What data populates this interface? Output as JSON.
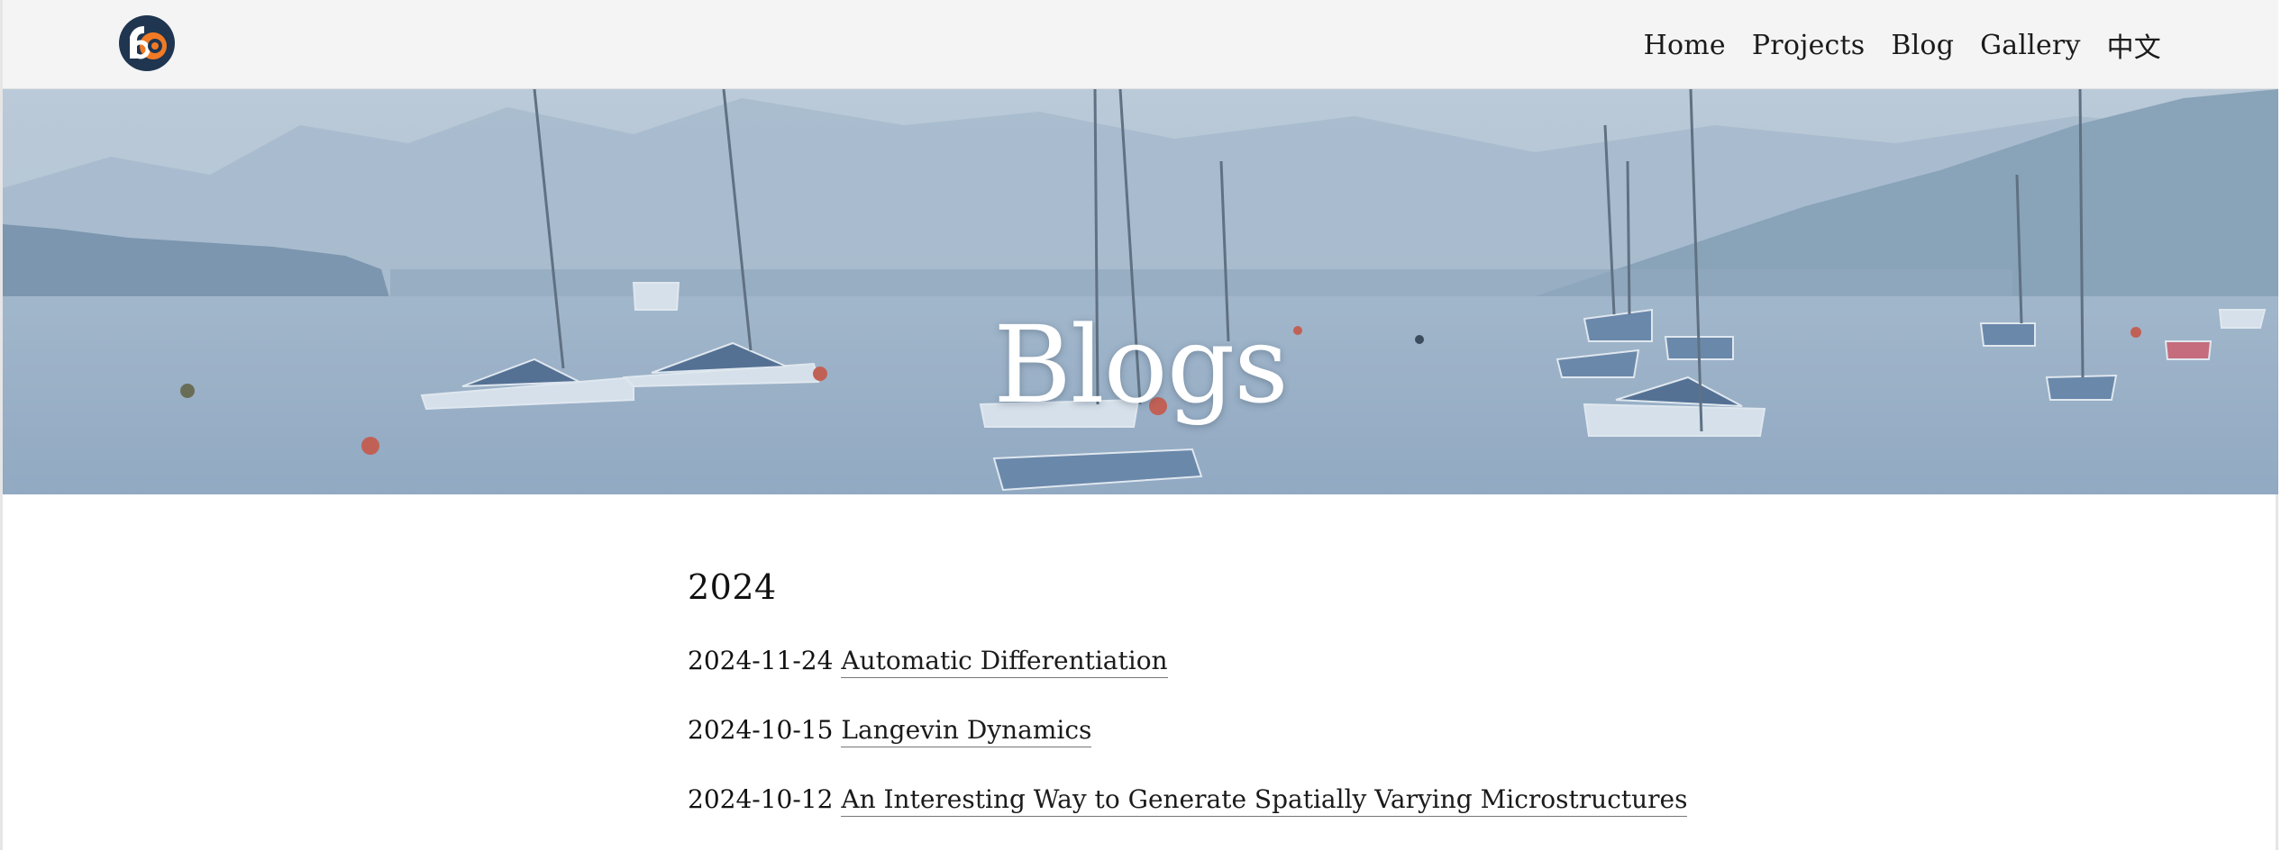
{
  "navbar": {
    "logo_icon": "circular-logo-icon",
    "links": [
      "Home",
      "Projects",
      "Blog",
      "Gallery",
      "中文"
    ]
  },
  "hero": {
    "title": "Blogs"
  },
  "archive": {
    "year": "2024",
    "posts": [
      {
        "date": "2024-11-24",
        "title": "Automatic Differentiation"
      },
      {
        "date": "2024-10-15",
        "title": "Langevin Dynamics"
      },
      {
        "date": "2024-10-12",
        "title": "An Interesting Way to Generate Spatially Varying Microstructures"
      }
    ]
  },
  "colors": {
    "navbar_bg": "#f4f4f4",
    "logo_navy": "#1f3550",
    "logo_orange": "#f07a25",
    "sky": "#aebfd0",
    "water": "#8fa9c4"
  }
}
